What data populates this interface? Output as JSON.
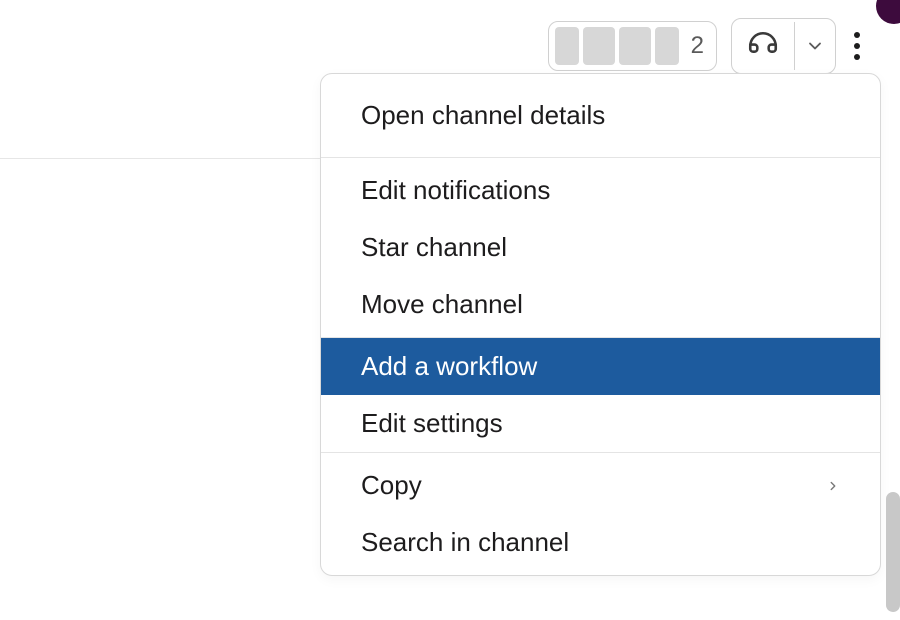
{
  "header": {
    "member_count": "2"
  },
  "menu": {
    "open_details": "Open channel details",
    "edit_notifications": "Edit notifications",
    "star_channel": "Star channel",
    "move_channel": "Move channel",
    "add_workflow": "Add a workflow",
    "edit_settings": "Edit settings",
    "copy": "Copy",
    "search_in_channel": "Search in channel"
  },
  "colors": {
    "highlight": "#1d5b9e"
  }
}
